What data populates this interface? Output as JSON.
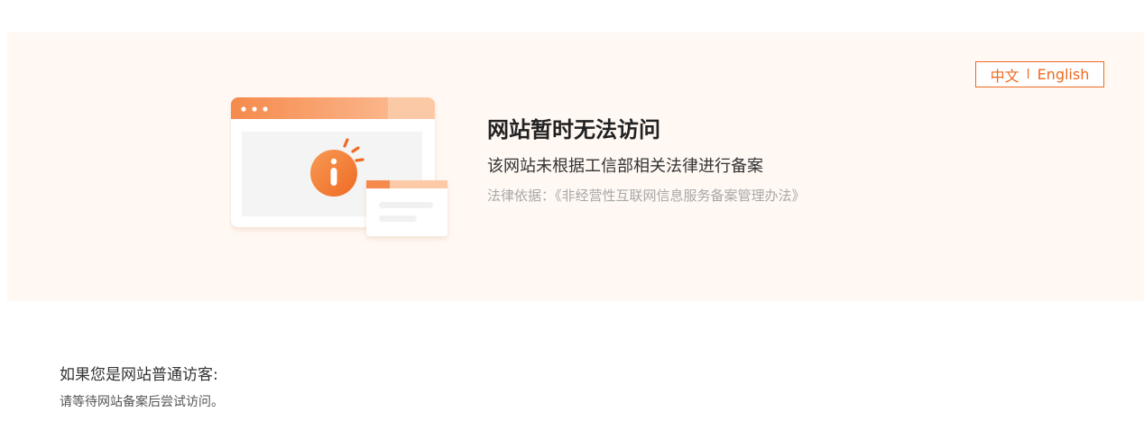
{
  "language_switch": {
    "chinese": "中文",
    "separator": "l",
    "english": "English"
  },
  "notice": {
    "title": "网站暂时无法访问",
    "subtitle": "该网站未根据工信部相关法律进行备案",
    "legal_basis": "法律依据：《非经营性互联网信息服务备案管理办法》"
  },
  "visitor_section": {
    "heading": "如果您是网站普通访客:",
    "instruction": "请等待网站备案后尝试访问。"
  },
  "icons": {
    "illustration": "browser-window-info-icon"
  },
  "colors": {
    "accent": "#ee6a1f",
    "banner_bg": "#fff8f3"
  }
}
